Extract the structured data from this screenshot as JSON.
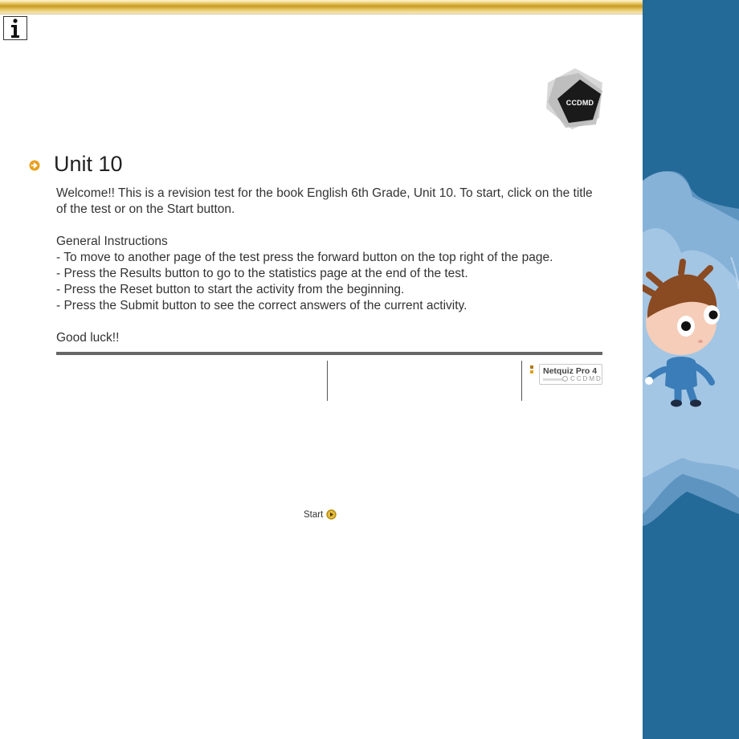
{
  "unit": {
    "title": "Unit 10",
    "welcome": "Welcome!! This is a revision test for the book English 6th Grade, Unit 10. To start, click on the title of the test or on the Start button.",
    "instructions_heading": "General Instructions",
    "instructions": [
      "- To move to another page of the test press the forward button on the top right of the page.",
      "- Press the Results button to go to the statistics page at the end of the test.",
      "- Press the Reset button to start the activity from the beginning.",
      "- Press the Submit button to see the correct answers of the current activity."
    ],
    "closing": "Good luck!!"
  },
  "logo": {
    "text": "CCDMD"
  },
  "badge": {
    "title": "Netquiz Pro 4",
    "subtitle": "CCDMD"
  },
  "start": {
    "label": "Start"
  },
  "icons": {
    "info": "info-icon",
    "bullet": "arrow-bullet-icon",
    "start": "play-icon",
    "logo": "ccdmd-logo",
    "mascot": "cartoon-mascot"
  },
  "colors": {
    "accent_gold": "#c79a22",
    "bullet_orange": "#e8a020",
    "side_blue": "#236a98",
    "divider_gray": "#666666"
  }
}
